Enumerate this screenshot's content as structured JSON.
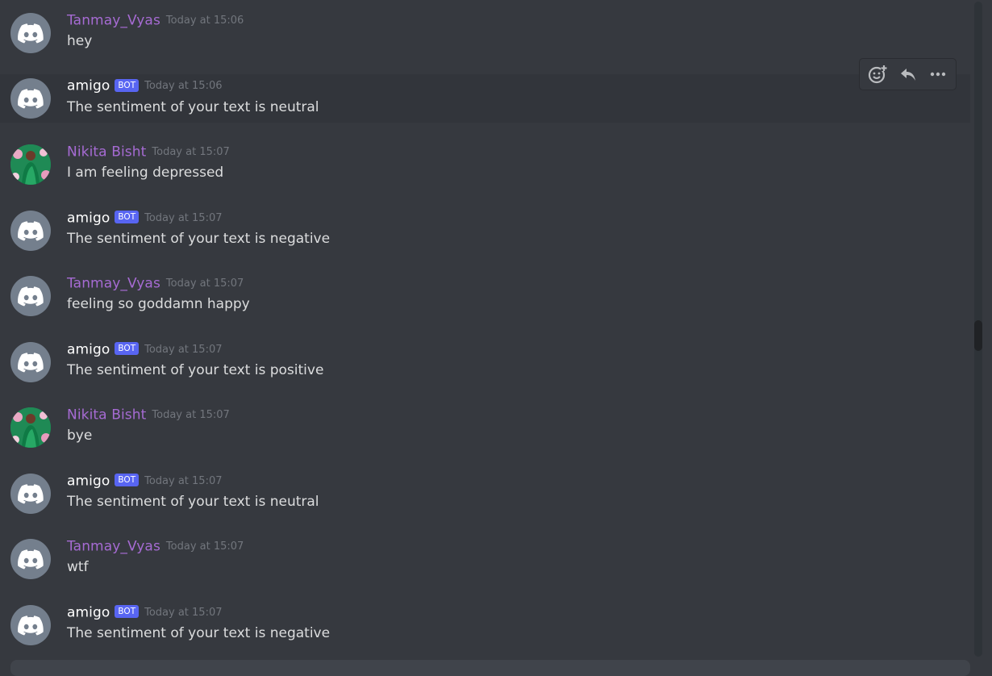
{
  "colors": {
    "background": "#36393f",
    "user_name": "#a66bd3",
    "bot_name": "#ffffff",
    "bot_tag": "#5865f2",
    "timestamp": "#72767d",
    "text": "#dcddde"
  },
  "toolbar": {
    "add_reaction_icon": "emoji-add-icon",
    "reply_icon": "reply-icon",
    "more_icon": "more-horizontal-icon"
  },
  "messages": [
    {
      "author": "Tanmay_Vyas",
      "bot": false,
      "avatar": "discord-default",
      "timestamp": "Today at 15:06",
      "text": "hey"
    },
    {
      "author": "amigo",
      "bot": true,
      "bot_tag": "BOT",
      "avatar": "discord-default",
      "timestamp": "Today at 15:06",
      "text": "The sentiment of your text is neutral"
    },
    {
      "author": "Nikita Bisht",
      "bot": false,
      "avatar": "photo",
      "timestamp": "Today at 15:07",
      "text": "I am feeling depressed"
    },
    {
      "author": "amigo",
      "bot": true,
      "bot_tag": "BOT",
      "avatar": "discord-default",
      "timestamp": "Today at 15:07",
      "text": "The sentiment of your text is negative"
    },
    {
      "author": "Tanmay_Vyas",
      "bot": false,
      "avatar": "discord-default",
      "timestamp": "Today at 15:07",
      "text": "feeling so goddamn happy"
    },
    {
      "author": "amigo",
      "bot": true,
      "bot_tag": "BOT",
      "avatar": "discord-default",
      "timestamp": "Today at 15:07",
      "text": "The sentiment of your text is positive"
    },
    {
      "author": "Nikita Bisht",
      "bot": false,
      "avatar": "photo",
      "timestamp": "Today at 15:07",
      "text": "bye"
    },
    {
      "author": "amigo",
      "bot": true,
      "bot_tag": "BOT",
      "avatar": "discord-default",
      "timestamp": "Today at 15:07",
      "text": "The sentiment of your text is neutral"
    },
    {
      "author": "Tanmay_Vyas",
      "bot": false,
      "avatar": "discord-default",
      "timestamp": "Today at 15:07",
      "text": "wtf"
    },
    {
      "author": "amigo",
      "bot": true,
      "bot_tag": "BOT",
      "avatar": "discord-default",
      "timestamp": "Today at 15:07",
      "text": "The sentiment of your text is negative"
    }
  ]
}
